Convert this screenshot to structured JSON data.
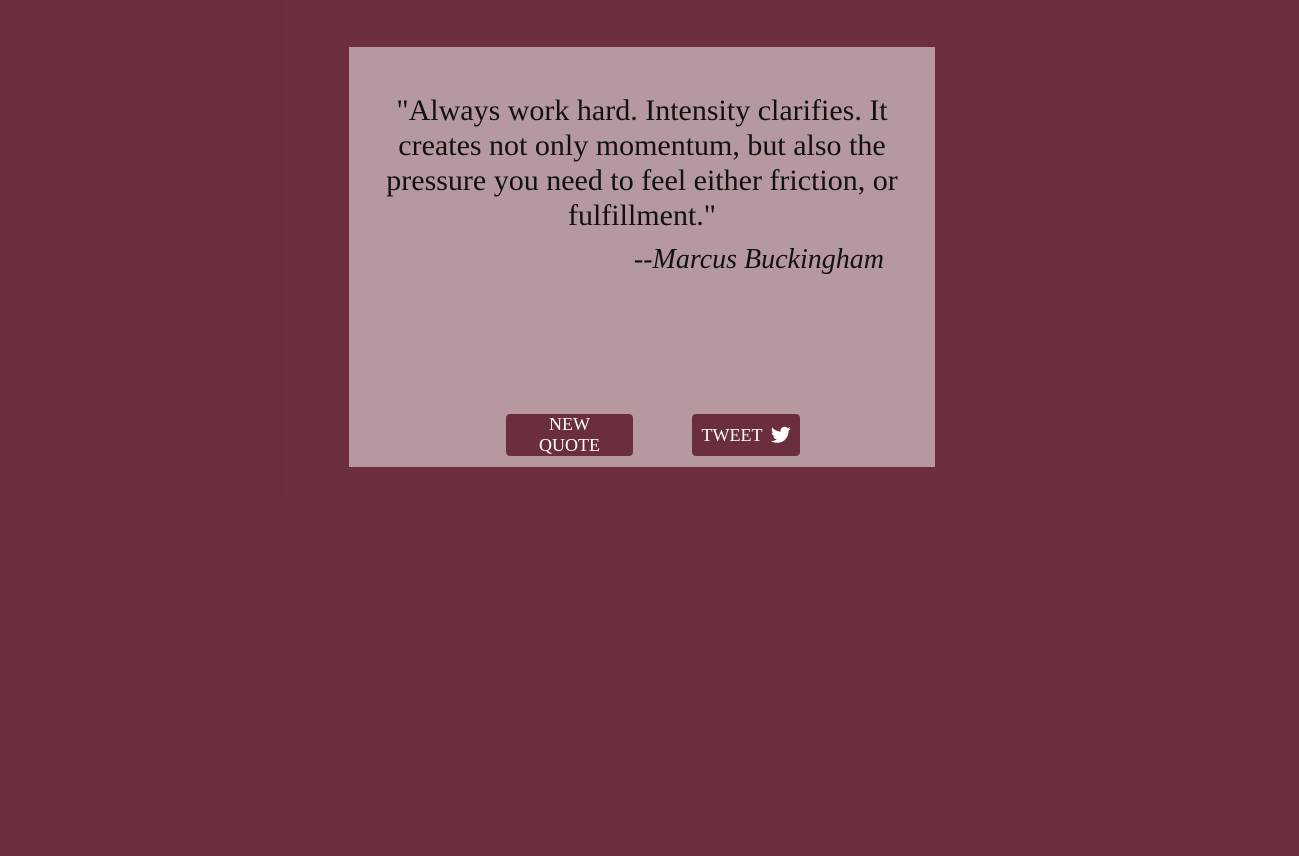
{
  "page": {
    "background_color": "#6b2e3c",
    "card_color": "#b5999e"
  },
  "quote": {
    "text": "\"Always work hard. Intensity clarifies. It creates not only momentum, but also the pressure you need to feel either friction, or fulfillment.\"",
    "author": "--Marcus Buckingham"
  },
  "buttons": {
    "new_quote_label": "NEW QUOTE",
    "tweet_label": "TWEET",
    "tweet_icon": "twitter-icon"
  }
}
